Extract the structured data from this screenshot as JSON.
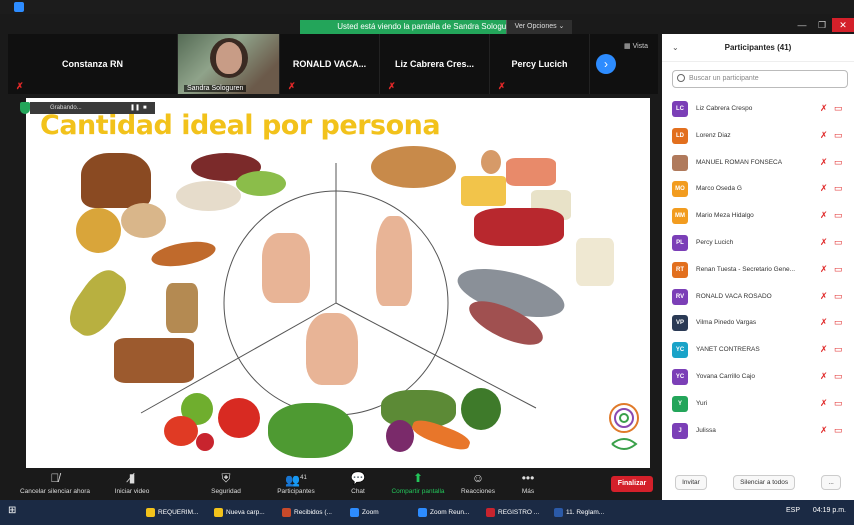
{
  "banner": "Usted está viendo la pantalla de Sandra Sologuren",
  "view_options": "Ver Opciones",
  "gallery": {
    "tiles": [
      "Constanza RN",
      "Sandra Sologuren",
      "RONALD VACA...",
      "Liz Cabrera Cres...",
      "Percy Lucich"
    ],
    "vista": "Vista"
  },
  "recording": "Grabando...",
  "slide": {
    "title": "Cantidad ideal por persona"
  },
  "panel": {
    "title": "Participantes (41)",
    "search_placeholder": "Buscar un participante",
    "participants": [
      {
        "initials": "LC",
        "name": "Liz Cabrera Crespo",
        "color": "#7b3fb7"
      },
      {
        "initials": "LD",
        "name": "Lorenz Diaz",
        "color": "#e26f1e"
      },
      {
        "initials": "",
        "name": "MANUEL ROMÁN FONSECA",
        "color": "#b07a5c"
      },
      {
        "initials": "MO",
        "name": "Marco Oseda G",
        "color": "#f29c1f"
      },
      {
        "initials": "MM",
        "name": "Mario Meza Hidalgo",
        "color": "#f29c1f"
      },
      {
        "initials": "PL",
        "name": "Percy Lucich",
        "color": "#7b3fb7"
      },
      {
        "initials": "RT",
        "name": "Renan Tuesta - Secretario Gene...",
        "color": "#e26f1e"
      },
      {
        "initials": "RV",
        "name": "RONALD VACA ROSADO",
        "color": "#7b3fb7"
      },
      {
        "initials": "VP",
        "name": "Vilma Pinedo Vargas",
        "color": "#2b3a55"
      },
      {
        "initials": "YC",
        "name": "YANET CONTRERAS",
        "color": "#1aa3c8"
      },
      {
        "initials": "YC",
        "name": "Yovana Carrillo Cajo",
        "color": "#7b3fb7"
      },
      {
        "initials": "Y",
        "name": "Yuri",
        "color": "#23a55a"
      },
      {
        "initials": "J",
        "name": "Julissa",
        "color": "#7b3fb7"
      }
    ],
    "invite": "Invitar",
    "mute_all": "Silenciar a todos",
    "more": "..."
  },
  "toolbar": {
    "mute": "Cancelar silenciar ahora",
    "video": "Iniciar video",
    "security": "Seguridad",
    "participants": "Participantes",
    "participants_count": "41",
    "chat": "Chat",
    "share": "Compartir pantalla",
    "reactions": "Reacciones",
    "more": "Más",
    "end": "Finalizar"
  },
  "taskbar": {
    "items": [
      "REQUERIM...",
      "Nueva carp...",
      "Recibidos (...",
      "Zoom",
      "Zoom Reun...",
      "REGISTRO ...",
      "11. Reglam..."
    ],
    "lang": "ESP",
    "time": "04:19 p.m."
  }
}
